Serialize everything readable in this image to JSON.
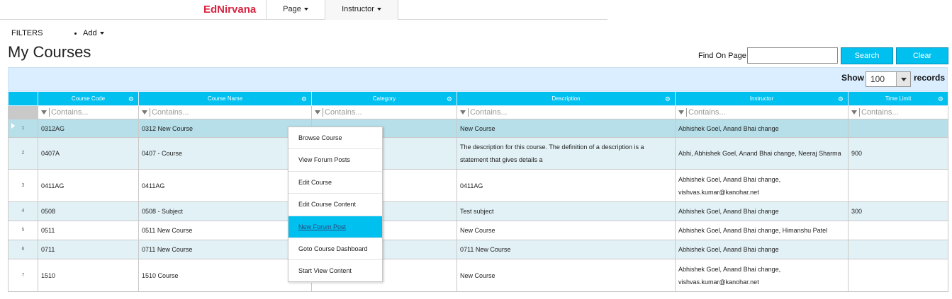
{
  "nav": {
    "brand": "EdNirvana",
    "page_menu": "Page",
    "instructor_menu": "Instructor"
  },
  "filters": {
    "label": "FILTERS",
    "add": "Add"
  },
  "page_title": "My Courses",
  "find": {
    "label": "Find On Page",
    "value": "",
    "search_label": "Search",
    "clear_label": "Clear"
  },
  "paging": {
    "show_label": "Show",
    "page_size": "100",
    "records_label": "records"
  },
  "grid": {
    "columns": [
      "Course Code",
      "Course Name",
      "Category",
      "Description",
      "Instructor",
      "Time Limit"
    ],
    "filter_placeholder": "Contains...",
    "rows": [
      {
        "num": "1",
        "code": "0312AG",
        "name": "0312 New Course",
        "category": "",
        "description": "New Course",
        "instructor": "Abhishek Goel, Anand Bhai change",
        "time_limit": ""
      },
      {
        "num": "2",
        "code": "0407A",
        "name": "0407 - Course",
        "category": "",
        "description": "The description for this course. The definition of a description is a statement that gives details a",
        "instructor": "Abhi, Abhishek Goel, Anand Bhai change, Neeraj Sharma",
        "time_limit": "900"
      },
      {
        "num": "3",
        "code": "0411AG",
        "name": "0411AG",
        "category": "",
        "description": "0411AG",
        "instructor": "Abhishek Goel, Anand Bhai change, vishvas.kumar@kanohar.net",
        "time_limit": ""
      },
      {
        "num": "4",
        "code": "0508",
        "name": "0508 - Subject",
        "category": "",
        "description": "Test subject",
        "instructor": "Abhishek Goel, Anand Bhai change",
        "time_limit": "300"
      },
      {
        "num": "5",
        "code": "0511",
        "name": "0511 New Course",
        "category": "",
        "description": "New Course",
        "instructor": "Abhishek Goel, Anand Bhai change, Himanshu Patel",
        "time_limit": ""
      },
      {
        "num": "6",
        "code": "0711",
        "name": "0711 New Course",
        "category": "",
        "description": "0711 New Course",
        "instructor": "Abhishek Goel, Anand Bhai change",
        "time_limit": ""
      },
      {
        "num": "7",
        "code": "1510",
        "name": "1510 Course",
        "category": "",
        "description": "New Course",
        "instructor": "Abhishek Goel, Anand Bhai change, vishvas.kumar@kanohar.net",
        "time_limit": ""
      }
    ]
  },
  "context_menu": {
    "items": [
      "Browse Course",
      "View Forum Posts",
      "Edit Course",
      "Edit Course Content",
      "New Forum Post",
      "Goto Course Dashboard",
      "Start View Content"
    ],
    "highlighted": "New Forum Post"
  },
  "colors": {
    "accent": "#00c0f0",
    "brand": "#d9233f",
    "row_alt": "#e2f1f6",
    "row_selected": "#b6dfe9"
  }
}
